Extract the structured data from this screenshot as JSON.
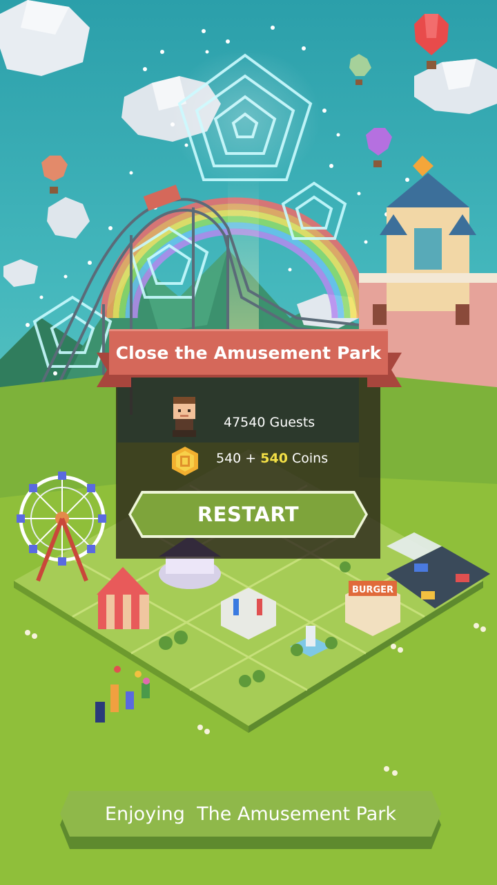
{
  "dialog": {
    "title": "Close the Amusement Park",
    "guests_text": "47540 Guests",
    "coins_base": "540 + ",
    "coins_bonus": "540",
    "coins_suffix": " Coins",
    "restart_label": "RESTART"
  },
  "footer": {
    "label": "Enjoying  The Amusement Park"
  },
  "colors": {
    "sky": "#2fa6b0",
    "grass": "#8fbf3a",
    "ribbon": "#d5685a",
    "button_green": "#7ea43b",
    "coin_bonus": "#f4e046"
  },
  "scene": {
    "burger_sign": "BURGER"
  }
}
